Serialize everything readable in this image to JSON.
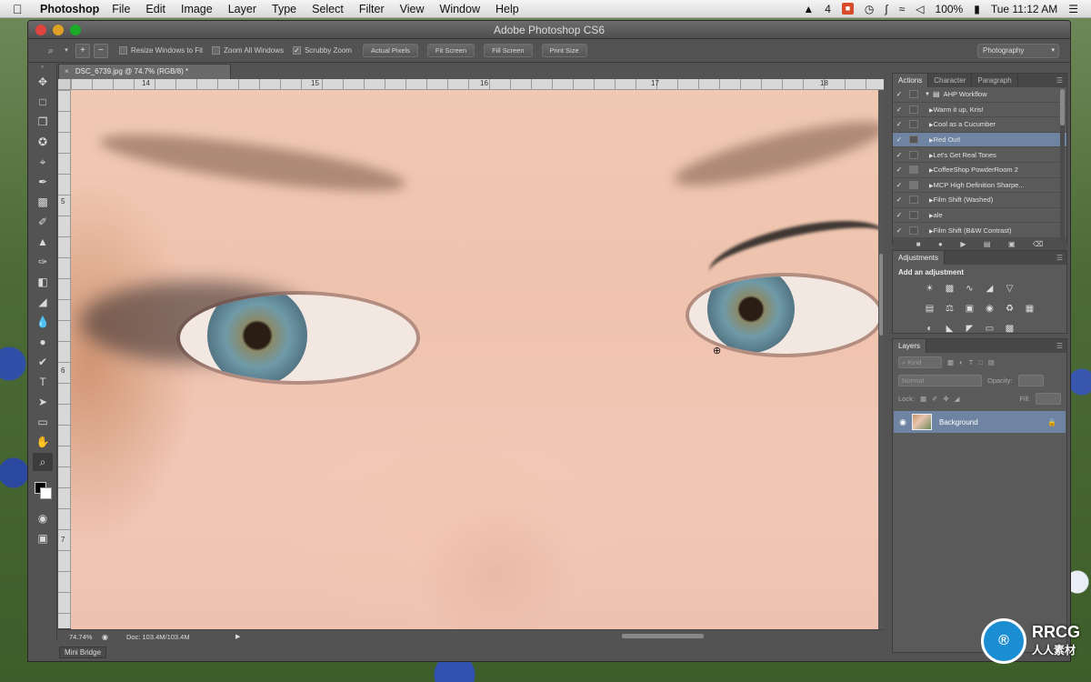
{
  "menubar": {
    "app_name": "Photoshop",
    "menus": [
      "File",
      "Edit",
      "Image",
      "Layer",
      "Type",
      "Select",
      "Filter",
      "View",
      "Window",
      "Help"
    ],
    "status": {
      "adobe_count": "4",
      "battery": "100%",
      "clock": "Tue 11:12 AM"
    }
  },
  "window": {
    "title": "Adobe Photoshop CS6"
  },
  "options_bar": {
    "resize_windows_label": "Resize Windows to Fit",
    "zoom_all_windows_label": "Zoom All Windows",
    "scrubby_zoom_label": "Scrubby Zoom",
    "scrubby_zoom_checked": true,
    "actual_pixels": "Actual Pixels",
    "fit_screen": "Fit Screen",
    "fill_screen": "Fill Screen",
    "print_size": "Print Size",
    "workspace": "Photography"
  },
  "document": {
    "tab_title": "DSC_6739.jpg @ 74.7% (RGB/8) *",
    "ruler_h_labels": [
      "14",
      "15",
      "16",
      "17",
      "18"
    ],
    "ruler_v_labels": [
      "5",
      "6",
      "7"
    ],
    "zoom_value": "74.74%",
    "doc_info": "Doc: 103.4M/103.4M"
  },
  "mini_bridge": "Mini Bridge",
  "actions_panel": {
    "tabs": [
      "Actions",
      "Character",
      "Paragraph"
    ],
    "set_name": "AHP Workflow",
    "items": [
      {
        "label": "Warm it up, Kris!",
        "dialog": false
      },
      {
        "label": "Cool as a Cucumber",
        "dialog": false
      },
      {
        "label": "Red Out!",
        "dialog": false,
        "selected": true
      },
      {
        "label": "Let's Get Real Tones",
        "dialog": false
      },
      {
        "label": "CoffeeShop PowderRoom 2",
        "dialog": true
      },
      {
        "label": "MCP High Definition Sharpe...",
        "dialog": true
      },
      {
        "label": "Film Shift (Washed)",
        "dialog": false
      },
      {
        "label": "ale",
        "dialog": false
      },
      {
        "label": "Film Shift (B&W Contrast)",
        "dialog": false
      }
    ]
  },
  "adjustments_panel": {
    "title": "Adjustments",
    "subtitle": "Add an adjustment"
  },
  "layers_panel": {
    "title": "Layers",
    "kind_filter": "Kind",
    "blend_mode": "Normal",
    "opacity_label": "Opacity:",
    "lock_label": "Lock:",
    "fill_label": "Fill:",
    "layer_name": "Background"
  },
  "watermark": {
    "brand": "RRCG",
    "brand_sub": "人人素材"
  },
  "colors": {
    "selection": "#6f84a3",
    "panel_bg": "#5a5a5a"
  }
}
